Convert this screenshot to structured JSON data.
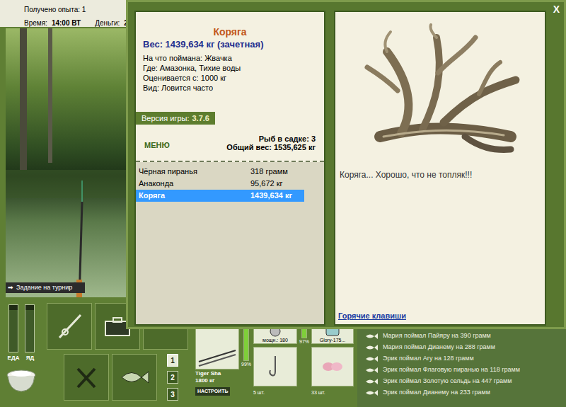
{
  "status": {
    "experience": "Получено опыта: 1",
    "time_label": "Время:",
    "time": "14:00 ВТ",
    "money_label": "Деньги:",
    "money": "2"
  },
  "tournament_button": {
    "icon": "➡",
    "label": "Задание на турнир"
  },
  "meters": [
    {
      "label": "ЕДА",
      "level": 0.9
    },
    {
      "label": "ЯД",
      "level": 0.9
    }
  ],
  "slot_buttons": [
    {
      "label": "1",
      "selected": true
    },
    {
      "label": "2",
      "selected": false
    },
    {
      "label": "3",
      "selected": false
    }
  ],
  "tackle": {
    "rod_name": "Tiger Sha",
    "rod_power": "1800 кг",
    "rod_condition": {
      "reading": "99%",
      "level": 0.99
    },
    "setup_button": "НАСТРОИТЬ",
    "reel_power": "мощн.: 180",
    "reel_condition": {
      "reading": "97%",
      "level": 0.97
    },
    "line_name": "Glory-175...",
    "hooks_count": "5 шт.",
    "bait_count": "33 шт."
  },
  "dialog": {
    "close": "X",
    "title": "Коряга",
    "weight": "Вес: 1439,634 кг (зачетная)",
    "details": [
      "На что поймана: Жвачка",
      "Где: Амазонка, Тихие воды",
      "Оценивается с: 1000 кг",
      "Вид: Ловится часто"
    ],
    "version_label": "Версия игры:",
    "version": "3.7.6",
    "menu": "МЕНЮ",
    "keep_count": "Рыб в садке: 3",
    "total_weight": "Общий вес: 1535,625 кг",
    "catches": [
      {
        "name": "Чёрная пиранья",
        "weight": "318 грамм",
        "selected": false
      },
      {
        "name": "Анаконда",
        "weight": "95,672 кг",
        "selected": false
      },
      {
        "name": "Коряга",
        "weight": "1439,634 кг",
        "selected": true
      }
    ],
    "caption": "Коряга... Хорошо, что не топляк!!!",
    "hotkeys": "Горячие клавиши"
  },
  "chat": [
    "Мария поймал Пайяру на 390 грамм",
    "Мария поймал Дианему на 288 грамм",
    "Эрик поймал Агу на 128 грамм",
    "Эрик поймал Флаговую пиранью на 118 грамм",
    "Эрик поймал Золотую сельдь на 447 грамм",
    "Эрик поймал Дианему на 233 грамм"
  ]
}
